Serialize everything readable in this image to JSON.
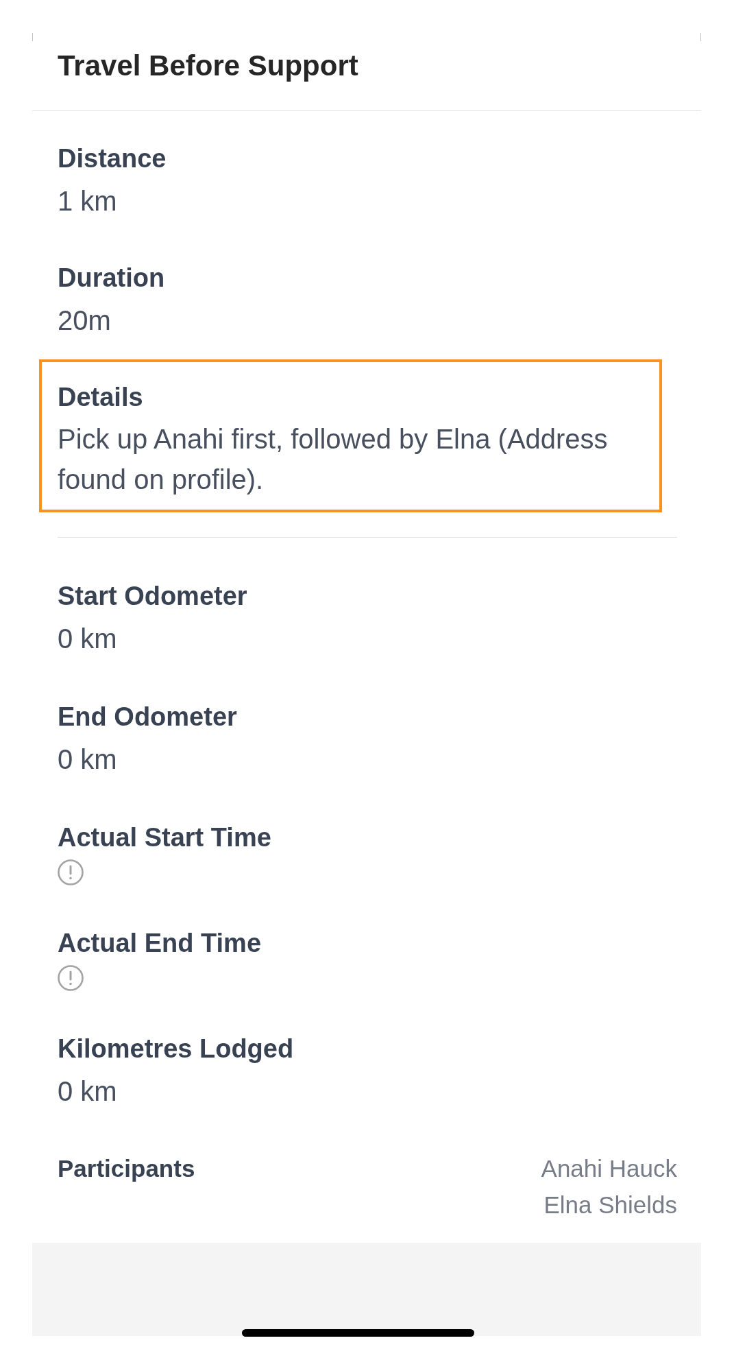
{
  "header": {
    "title": "Travel Before Support"
  },
  "sections": [
    {
      "fields": [
        {
          "kind": "text",
          "label": "Distance",
          "value": "1 km",
          "highlighted": false
        },
        {
          "kind": "text",
          "label": "Duration",
          "value": "20m",
          "highlighted": false
        },
        {
          "kind": "text",
          "label": "Details",
          "value": "Pick up Anahi first, followed by Elna (Address found on profile).",
          "highlighted": true
        }
      ]
    },
    {
      "fields": [
        {
          "kind": "text",
          "label": "Start Odometer",
          "value": "0 km",
          "highlighted": false
        },
        {
          "kind": "text",
          "label": "End Odometer",
          "value": "0 km",
          "highlighted": false
        },
        {
          "kind": "missing",
          "label": "Actual Start Time",
          "highlighted": false
        },
        {
          "kind": "missing",
          "label": "Actual End Time",
          "highlighted": false
        },
        {
          "kind": "text",
          "label": "Kilometres Lodged",
          "value": "0 km",
          "highlighted": false
        },
        {
          "kind": "list",
          "label": "Participants",
          "values": [
            "Anahi Hauck",
            "Elna Shields"
          ],
          "highlighted": false
        }
      ]
    }
  ]
}
